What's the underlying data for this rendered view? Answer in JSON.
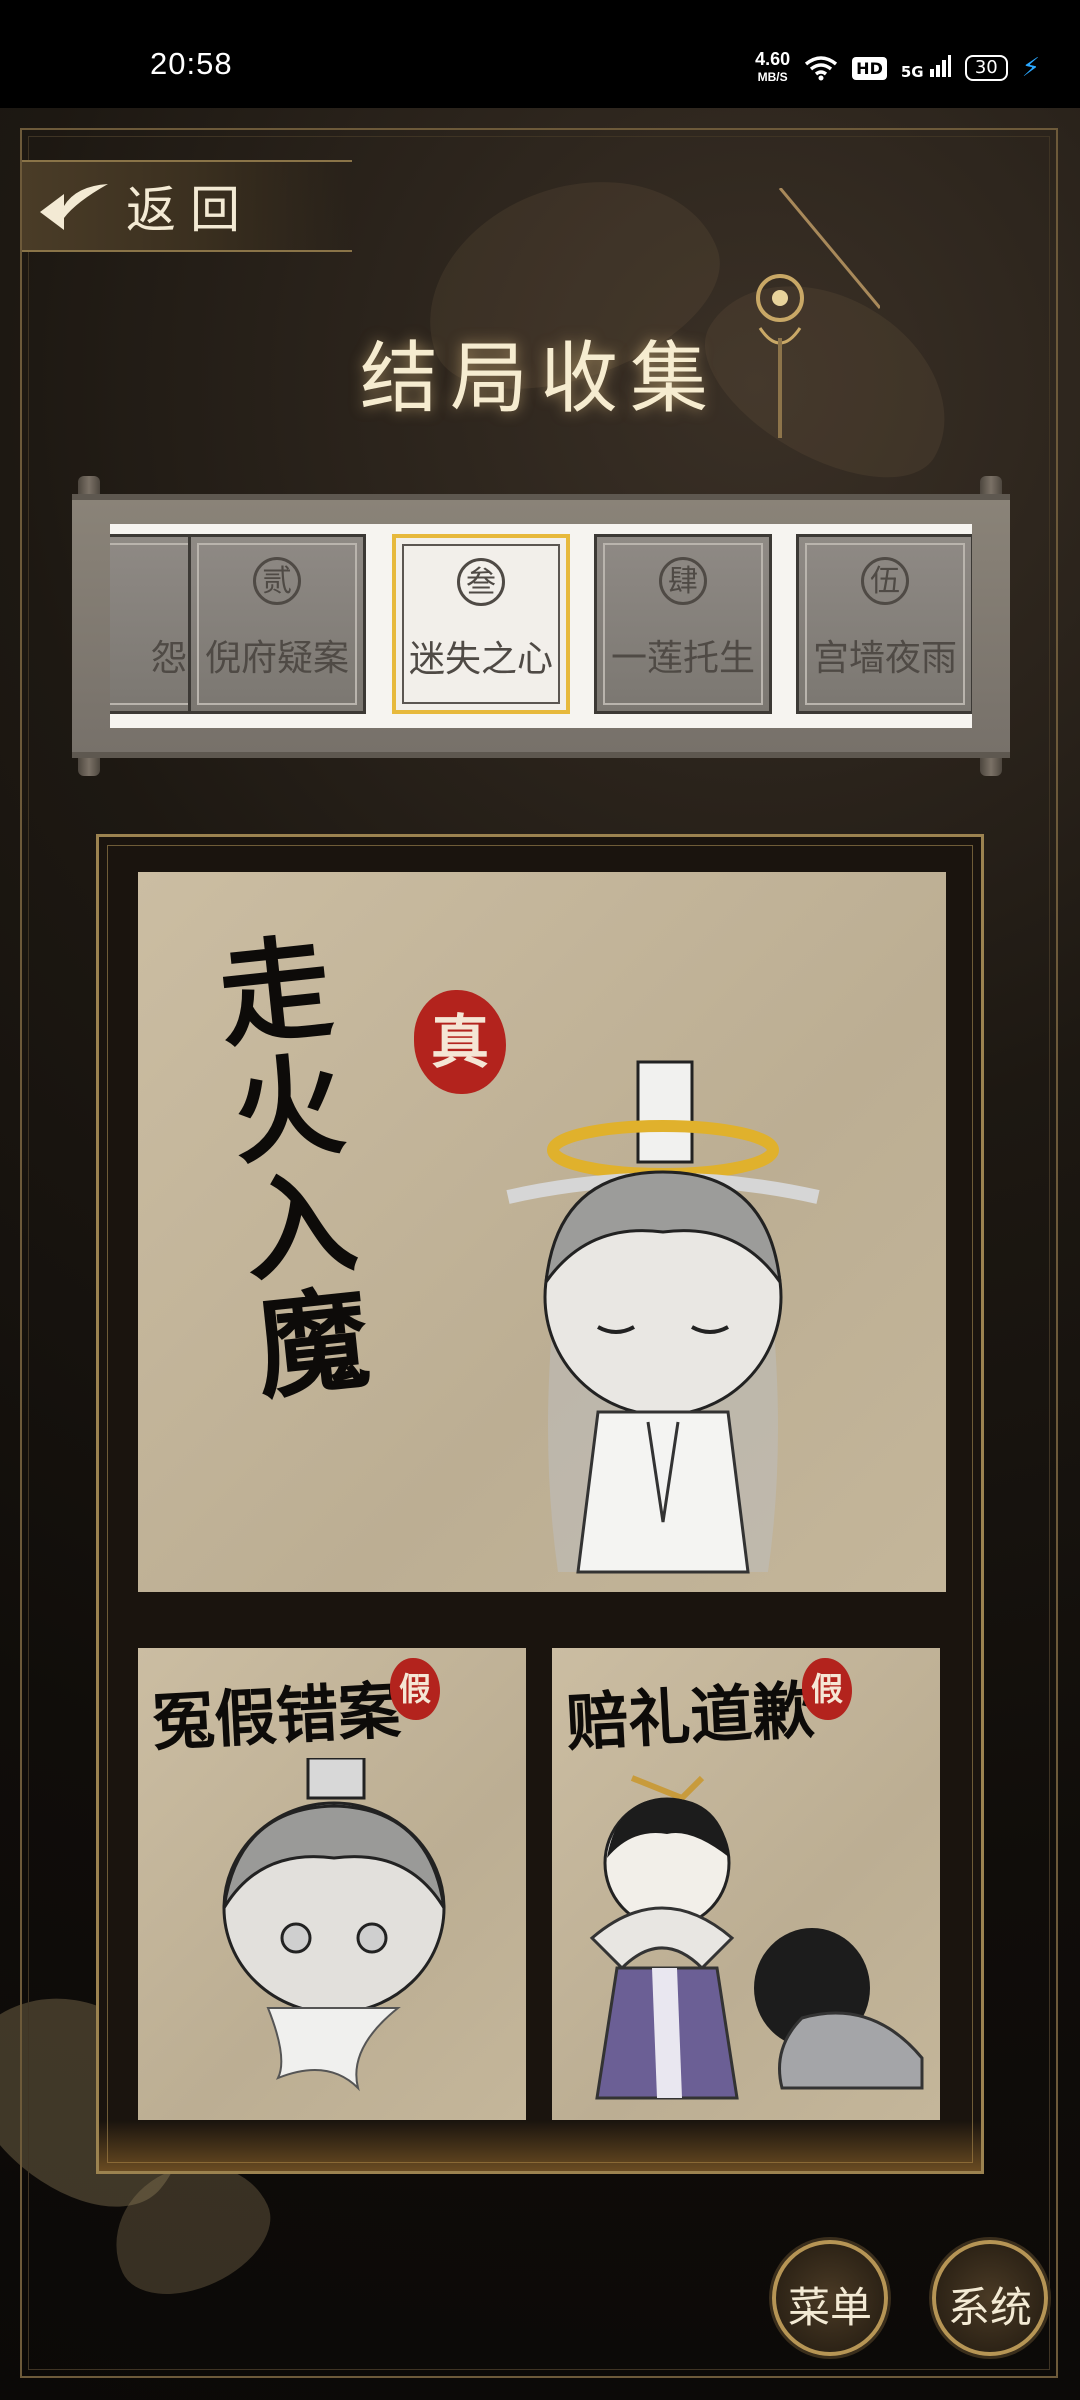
{
  "status_bar": {
    "time": "20:58",
    "net_speed": "4.60",
    "net_unit": "MB/S",
    "hd": "HD",
    "signal": "5G",
    "battery": "30"
  },
  "back_button": {
    "label": "返回"
  },
  "page_title": "结局收集",
  "chapters": [
    {
      "badge": "",
      "name": "怨",
      "selected": false
    },
    {
      "badge": "贰",
      "name": "倪府疑案",
      "selected": false
    },
    {
      "badge": "叁",
      "name": "迷失之心",
      "selected": true
    },
    {
      "badge": "肆",
      "name": "一莲托生",
      "selected": false
    },
    {
      "badge": "伍",
      "name": "宫墙夜雨",
      "selected": false
    }
  ],
  "endings": {
    "main": {
      "title": "走火入魔",
      "seal": "真"
    },
    "left": {
      "title": "冤假错案",
      "seal": "假"
    },
    "right": {
      "title": "赔礼道歉",
      "seal": "假"
    }
  },
  "bottom_buttons": {
    "menu": "菜单",
    "system": "系统"
  },
  "colors": {
    "accent_gold": "#e7b93c",
    "seal_red": "#b3231d",
    "paper": "#c7b89d"
  }
}
